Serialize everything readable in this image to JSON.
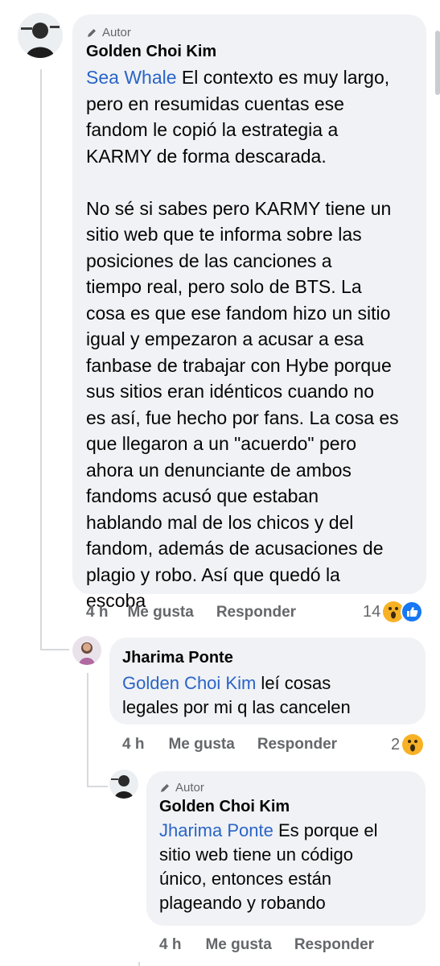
{
  "comments": [
    {
      "author_tag": "Autor",
      "name": "Golden Choi Kim",
      "mention": "Sea Whale",
      "text": " El contexto es muy largo,\npero en resumidas cuentas ese\nfandom le copió la estrategia a\nKARMY de forma descarada.\n\nNo sé si sabes pero KARMY tiene un\nsitio web que te informa sobre las\nposiciones de las canciones a\ntiempo real, pero solo de BTS. La\ncosa es que ese fandom hizo un sitio\nigual y empezaron a acusar a esa\nfanbase de trabajar con Hybe porque\nsus sitios eran idénticos cuando no\nes así, fue hecho por fans. La cosa es\nque llegaron a un \"acuerdo\" pero\nahora un denunciante de ambos\nfandoms acusó que estaban\nhablando mal de los chicos y del\nfandom, además de acusaciones de\nplagio y robo. Así que quedó la\nescoba",
      "time": "4 h",
      "like_label": "Me gusta",
      "reply_label": "Responder",
      "reaction_count": "14",
      "reaction_icons": [
        "wow-icon",
        "like-icon"
      ]
    },
    {
      "name": "Jharima Ponte",
      "mention": "Golden Choi Kim",
      "text": " leí cosas\nlegales por mi q las cancelen",
      "time": "4 h",
      "like_label": "Me gusta",
      "reply_label": "Responder",
      "reaction_count": "2",
      "reaction_icons": [
        "wow-icon"
      ]
    },
    {
      "author_tag": "Autor",
      "name": "Golden Choi Kim",
      "mention": "Jharima Ponte",
      "text": " Es porque el\nsitio web tiene un código\núnico, entonces están\nplageando y robando",
      "time": "4 h",
      "like_label": "Me gusta",
      "reply_label": "Responder"
    }
  ],
  "colors": {
    "bubble": "#f0f2f5",
    "mention": "#2a64c7",
    "meta": "#65676b",
    "like_blue": "#1877f2",
    "wow_yellow": "#f7b125"
  }
}
